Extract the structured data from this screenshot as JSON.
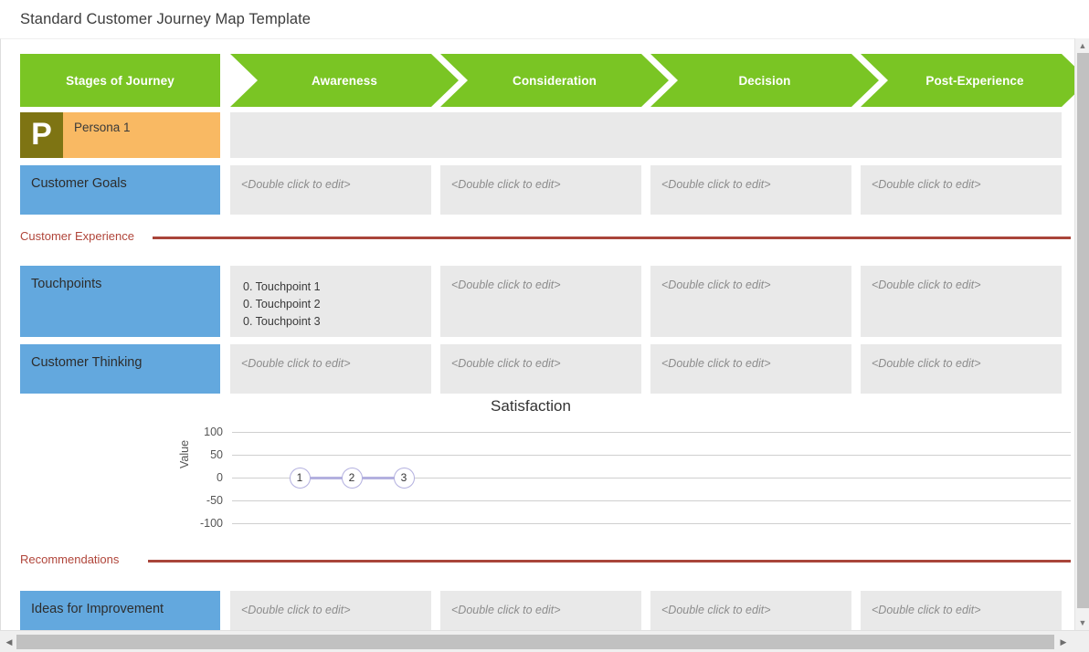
{
  "document": {
    "title": "Standard Customer Journey Map Template"
  },
  "stages": {
    "header_label": "Stages of Journey",
    "items": [
      {
        "label": "Awareness"
      },
      {
        "label": "Consideration"
      },
      {
        "label": "Decision"
      },
      {
        "label": "Post-Experience"
      }
    ]
  },
  "placeholder": "<Double click to edit>",
  "persona": {
    "initial": "P",
    "name": "Persona 1"
  },
  "rows": {
    "customer_goals": {
      "label": "Customer Goals",
      "cells": [
        "<Double click to edit>",
        "<Double click to edit>",
        "<Double click to edit>",
        "<Double click to edit>"
      ]
    },
    "touchpoints": {
      "label": "Touchpoints",
      "cells": [
        [
          "0. Touchpoint 1",
          "0. Touchpoint 2",
          "0. Touchpoint 3"
        ],
        "<Double click to edit>",
        "<Double click to edit>",
        "<Double click to edit>"
      ]
    },
    "customer_thinking": {
      "label": "Customer Thinking",
      "cells": [
        "<Double click to edit>",
        "<Double click to edit>",
        "<Double click to edit>",
        "<Double click to edit>"
      ]
    },
    "ideas_for_improvement": {
      "label": "Ideas for Improvement",
      "cells": [
        "<Double click to edit>",
        "<Double click to edit>",
        "<Double click to edit>",
        "<Double click to edit>"
      ]
    }
  },
  "sections": {
    "customer_experience": "Customer Experience",
    "recommendations": "Recommendations"
  },
  "touchpoint_items": {
    "t1": "0. Touchpoint 1",
    "t2": "0. Touchpoint 2",
    "t3": "0. Touchpoint 3"
  },
  "chart_data": {
    "type": "line",
    "title": "Satisfaction",
    "xlabel": "",
    "ylabel": "Value",
    "ylim": [
      -100,
      100
    ],
    "yticks": [
      100,
      50,
      0,
      -50,
      -100
    ],
    "grid": true,
    "legend": false,
    "point_labels": [
      "1",
      "2",
      "3"
    ],
    "x": [
      1,
      2,
      3
    ],
    "series": [
      {
        "name": "Satisfaction",
        "values": [
          0,
          0,
          0
        ],
        "color": "#b3b0df"
      }
    ]
  },
  "colors": {
    "stage_green": "#7ac524",
    "row_label_blue": "#63a8de",
    "persona_orange": "#f9b963",
    "persona_avatar_olive": "#7e7413",
    "cell_gray": "#e9e9e9",
    "section_red": "#a9453a",
    "series_purple": "#b3b0df"
  },
  "scrollbars": {
    "vertical_up_icon": "▲",
    "vertical_down_icon": "▼",
    "horizontal_left_icon": "◀",
    "horizontal_right_icon": "▶"
  }
}
